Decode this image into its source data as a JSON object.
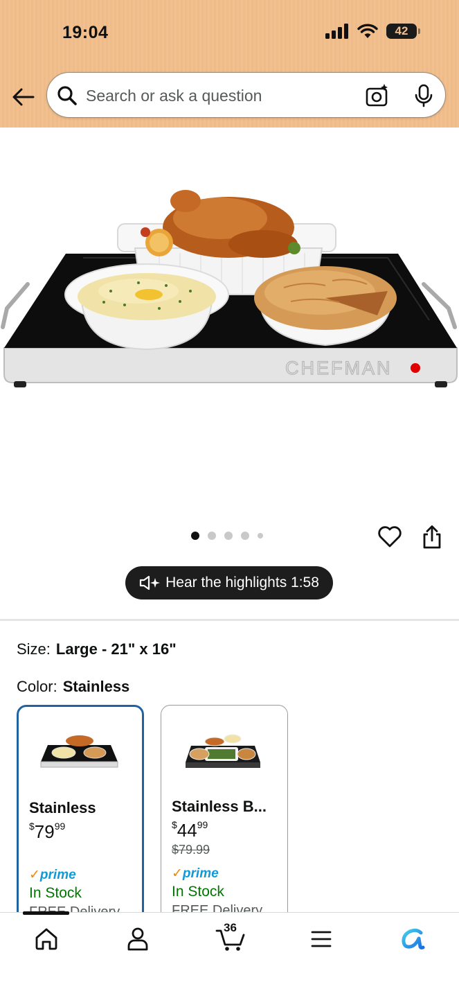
{
  "status_bar": {
    "time": "19:04",
    "battery": "42"
  },
  "search": {
    "placeholder": "Search or ask a question"
  },
  "gallery": {
    "image_count": 5,
    "active_index": 0
  },
  "audio": {
    "label": "Hear the highlights 1:58"
  },
  "options": {
    "size_label": "Size:",
    "size_value": "Large - 21\" x 16\"",
    "color_label": "Color:",
    "color_value": "Stainless"
  },
  "variants": [
    {
      "name": "Stainless",
      "currency": "$",
      "price_whole": "79",
      "price_fraction": "99",
      "list_price": "",
      "prime": "prime",
      "stock": "In Stock",
      "delivery": "FREE Delivery",
      "selected": true
    },
    {
      "name": "Stainless B...",
      "currency": "$",
      "price_whole": "44",
      "price_fraction": "99",
      "list_price": "$79.99",
      "prime": "prime",
      "stock": "In Stock",
      "delivery": "FREE Delivery",
      "selected": false
    }
  ],
  "nav": {
    "cart_count": "36"
  },
  "icons": {
    "back": "arrow-left-icon",
    "search": "search-icon",
    "camera": "camera-search-icon",
    "mic": "microphone-icon",
    "heart": "heart-icon",
    "share": "share-icon",
    "speaker": "speaker-sparkle-icon",
    "home": "home-icon",
    "account": "person-icon",
    "cart": "cart-icon",
    "menu": "menu-icon",
    "assistant": "rufus-icon"
  },
  "colors": {
    "header_bg": "#f2c08f",
    "selected_border": "#2162a1",
    "stock_green": "#007600",
    "prime_blue": "#1399d6",
    "prime_check": "#f08804"
  }
}
